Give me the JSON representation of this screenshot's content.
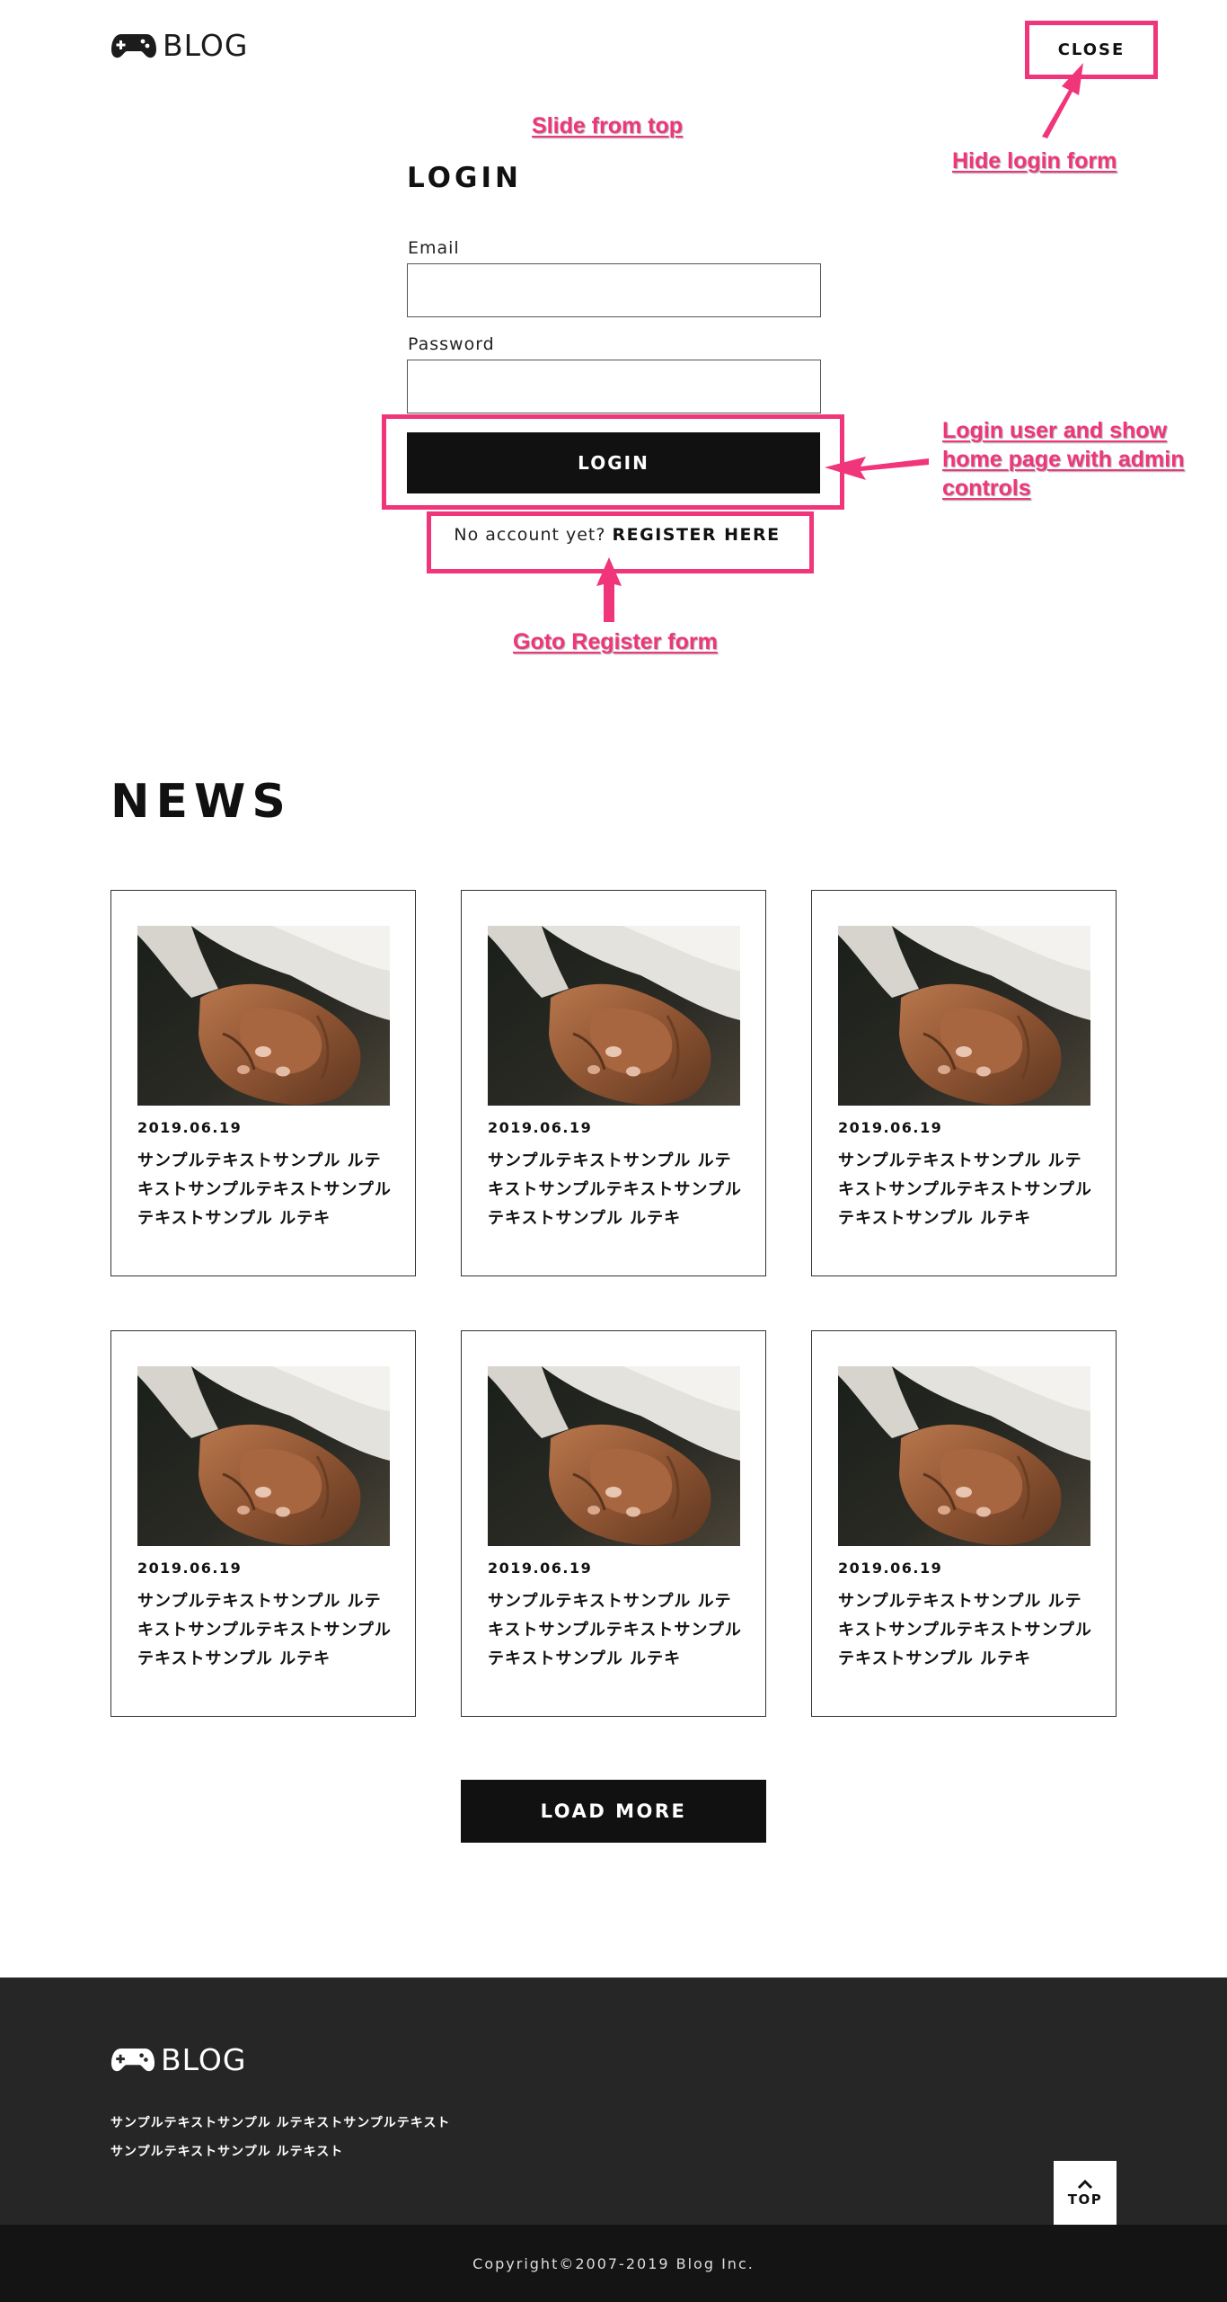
{
  "header": {
    "logo_text": "BLOG",
    "close_label": "CLOSE"
  },
  "annotations": {
    "slide_from_top": "Slide from top",
    "hide_login": "Hide login form",
    "login_action_lines": [
      "Login user and show",
      "home page with admin",
      "controls"
    ],
    "goto_register": "Goto Register form",
    "color": "#f0357a"
  },
  "login": {
    "title": "LOGIN",
    "email_label": "Email",
    "email_value": "",
    "password_label": "Password",
    "password_value": "",
    "submit_label": "LOGIN",
    "no_account_text": "No account yet?",
    "register_link": "REGISTER HERE"
  },
  "news": {
    "heading": "NEWS",
    "cards": [
      {
        "date": "2019.06.19",
        "excerpt": "サンプルテキストサンプル ルテキストサンプルテキストサンプルテキストサンプル ルテキ"
      },
      {
        "date": "2019.06.19",
        "excerpt": "サンプルテキストサンプル ルテキストサンプルテキストサンプルテキストサンプル ルテキ"
      },
      {
        "date": "2019.06.19",
        "excerpt": "サンプルテキストサンプル ルテキストサンプルテキストサンプルテキストサンプル ルテキ"
      },
      {
        "date": "2019.06.19",
        "excerpt": "サンプルテキストサンプル ルテキストサンプルテキストサンプルテキストサンプル ルテキ"
      },
      {
        "date": "2019.06.19",
        "excerpt": "サンプルテキストサンプル ルテキストサンプルテキストサンプルテキストサンプル ルテキ"
      },
      {
        "date": "2019.06.19",
        "excerpt": "サンプルテキストサンプル ルテキストサンプルテキストサンプルテキストサンプル ルテキ"
      }
    ],
    "load_more_label": "LOAD MORE"
  },
  "footer": {
    "logo_text": "BLOG",
    "text_line1": "サンプルテキストサンプル ルテキストサンプルテキスト",
    "text_line2": "サンプルテキストサンプル ルテキスト",
    "top_label": "TOP",
    "copyright": "Copyright©2007-2019 Blog Inc."
  },
  "icons": {
    "logo": "gamepad-icon",
    "card_image": "holding-hands-photo",
    "top": "chevron-up-icon"
  },
  "colors": {
    "accent": "#f0357a",
    "button_dark": "#111111",
    "footer_bg": "#262626",
    "bottom_bar_bg": "#141414"
  }
}
